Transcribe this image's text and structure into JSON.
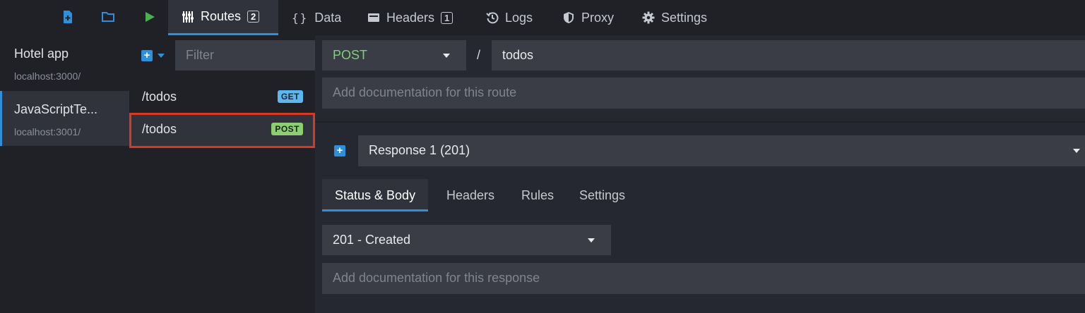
{
  "colors": {
    "accent": "#2e8fdc",
    "get_badge": "#5db7ef",
    "post_badge": "#8ccf6e",
    "highlight": "#d63a24",
    "method_text": "#7fcf7a"
  },
  "toolbar": {
    "icons": [
      "new-file-icon",
      "open-folder-icon",
      "play-icon"
    ],
    "tabs": [
      {
        "label": "Routes",
        "count": "2",
        "icon": "routes-icon"
      },
      {
        "label": "Data",
        "icon": "braces-icon"
      },
      {
        "label": "Headers",
        "count": "1",
        "icon": "headers-icon"
      },
      {
        "label": "Logs",
        "icon": "history-icon"
      },
      {
        "label": "Proxy",
        "icon": "shield-icon"
      },
      {
        "label": "Settings",
        "icon": "gear-icon"
      }
    ]
  },
  "environments": [
    {
      "name": "Hotel app",
      "host": "localhost:3000/"
    },
    {
      "name": "JavaScriptTe...",
      "host": "localhost:3001/"
    }
  ],
  "routes_panel": {
    "filter_placeholder": "Filter",
    "routes": [
      {
        "path": "/todos",
        "method": "GET"
      },
      {
        "path": "/todos",
        "method": "POST"
      }
    ]
  },
  "route_editor": {
    "method": "POST",
    "separator": "/",
    "path": "todos",
    "documentation_placeholder": "Add documentation for this route"
  },
  "response": {
    "selected": "Response 1 (201)",
    "tabs": [
      "Status & Body",
      "Headers",
      "Rules",
      "Settings"
    ],
    "status": "201 - Created",
    "documentation_placeholder": "Add documentation for this response"
  }
}
